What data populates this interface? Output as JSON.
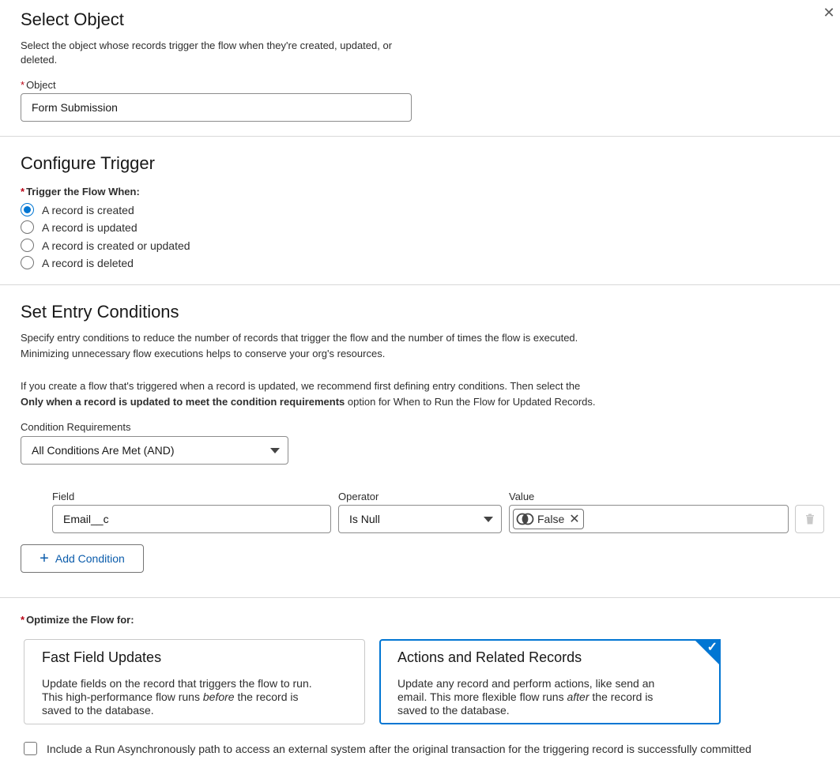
{
  "close_label": "✕",
  "select_object": {
    "title": "Select Object",
    "help": "Select the object whose records trigger the flow when they're created, updated, or deleted.",
    "field_label": "Object",
    "field_value": "Form Submission"
  },
  "configure_trigger": {
    "title": "Configure Trigger",
    "group_label": "Trigger the Flow When:",
    "options": [
      {
        "label": "A record is created",
        "selected": true
      },
      {
        "label": "A record is updated",
        "selected": false
      },
      {
        "label": "A record is created or updated",
        "selected": false
      },
      {
        "label": "A record is deleted",
        "selected": false
      }
    ]
  },
  "entry_conditions": {
    "title": "Set Entry Conditions",
    "help_line1": "Specify entry conditions to reduce the number of records that trigger the flow and the number of times the flow is executed.",
    "help_line2": "Minimizing unnecessary flow executions helps to conserve your org's resources.",
    "note_line1": "If you create a flow that's triggered when a record is updated, we recommend first defining entry conditions. Then select the",
    "note_bold": "Only when a record is updated to meet the condition requirements",
    "note_tail": " option for When to Run the Flow for Updated Records.",
    "requirements_label": "Condition Requirements",
    "requirements_value": "All Conditions Are Met (AND)",
    "col_field": "Field",
    "col_operator": "Operator",
    "col_value": "Value",
    "row": {
      "field": "Email__c",
      "operator": "Is Null",
      "value": "False"
    },
    "add_condition": "Add Condition"
  },
  "optimize": {
    "label": "Optimize the Flow for:",
    "fast": {
      "title": "Fast Field Updates",
      "desc1": "Update fields on the record that triggers the flow to run.",
      "desc2a": "This high-performance flow runs ",
      "desc2em": "before",
      "desc2b": " the record is",
      "desc3": "saved to the database."
    },
    "actions": {
      "title": "Actions and Related Records",
      "desc1": "Update any record and perform actions, like send an",
      "desc2a": "email. This more flexible flow runs ",
      "desc2em": "after",
      "desc2b": " the record is",
      "desc3": "saved to the database."
    },
    "async_label": "Include a Run Asynchronously path to access an external system after the original transaction for the triggering record is successfully committed"
  },
  "colors": {
    "brand": "#0176d3",
    "required": "#ba0517"
  }
}
